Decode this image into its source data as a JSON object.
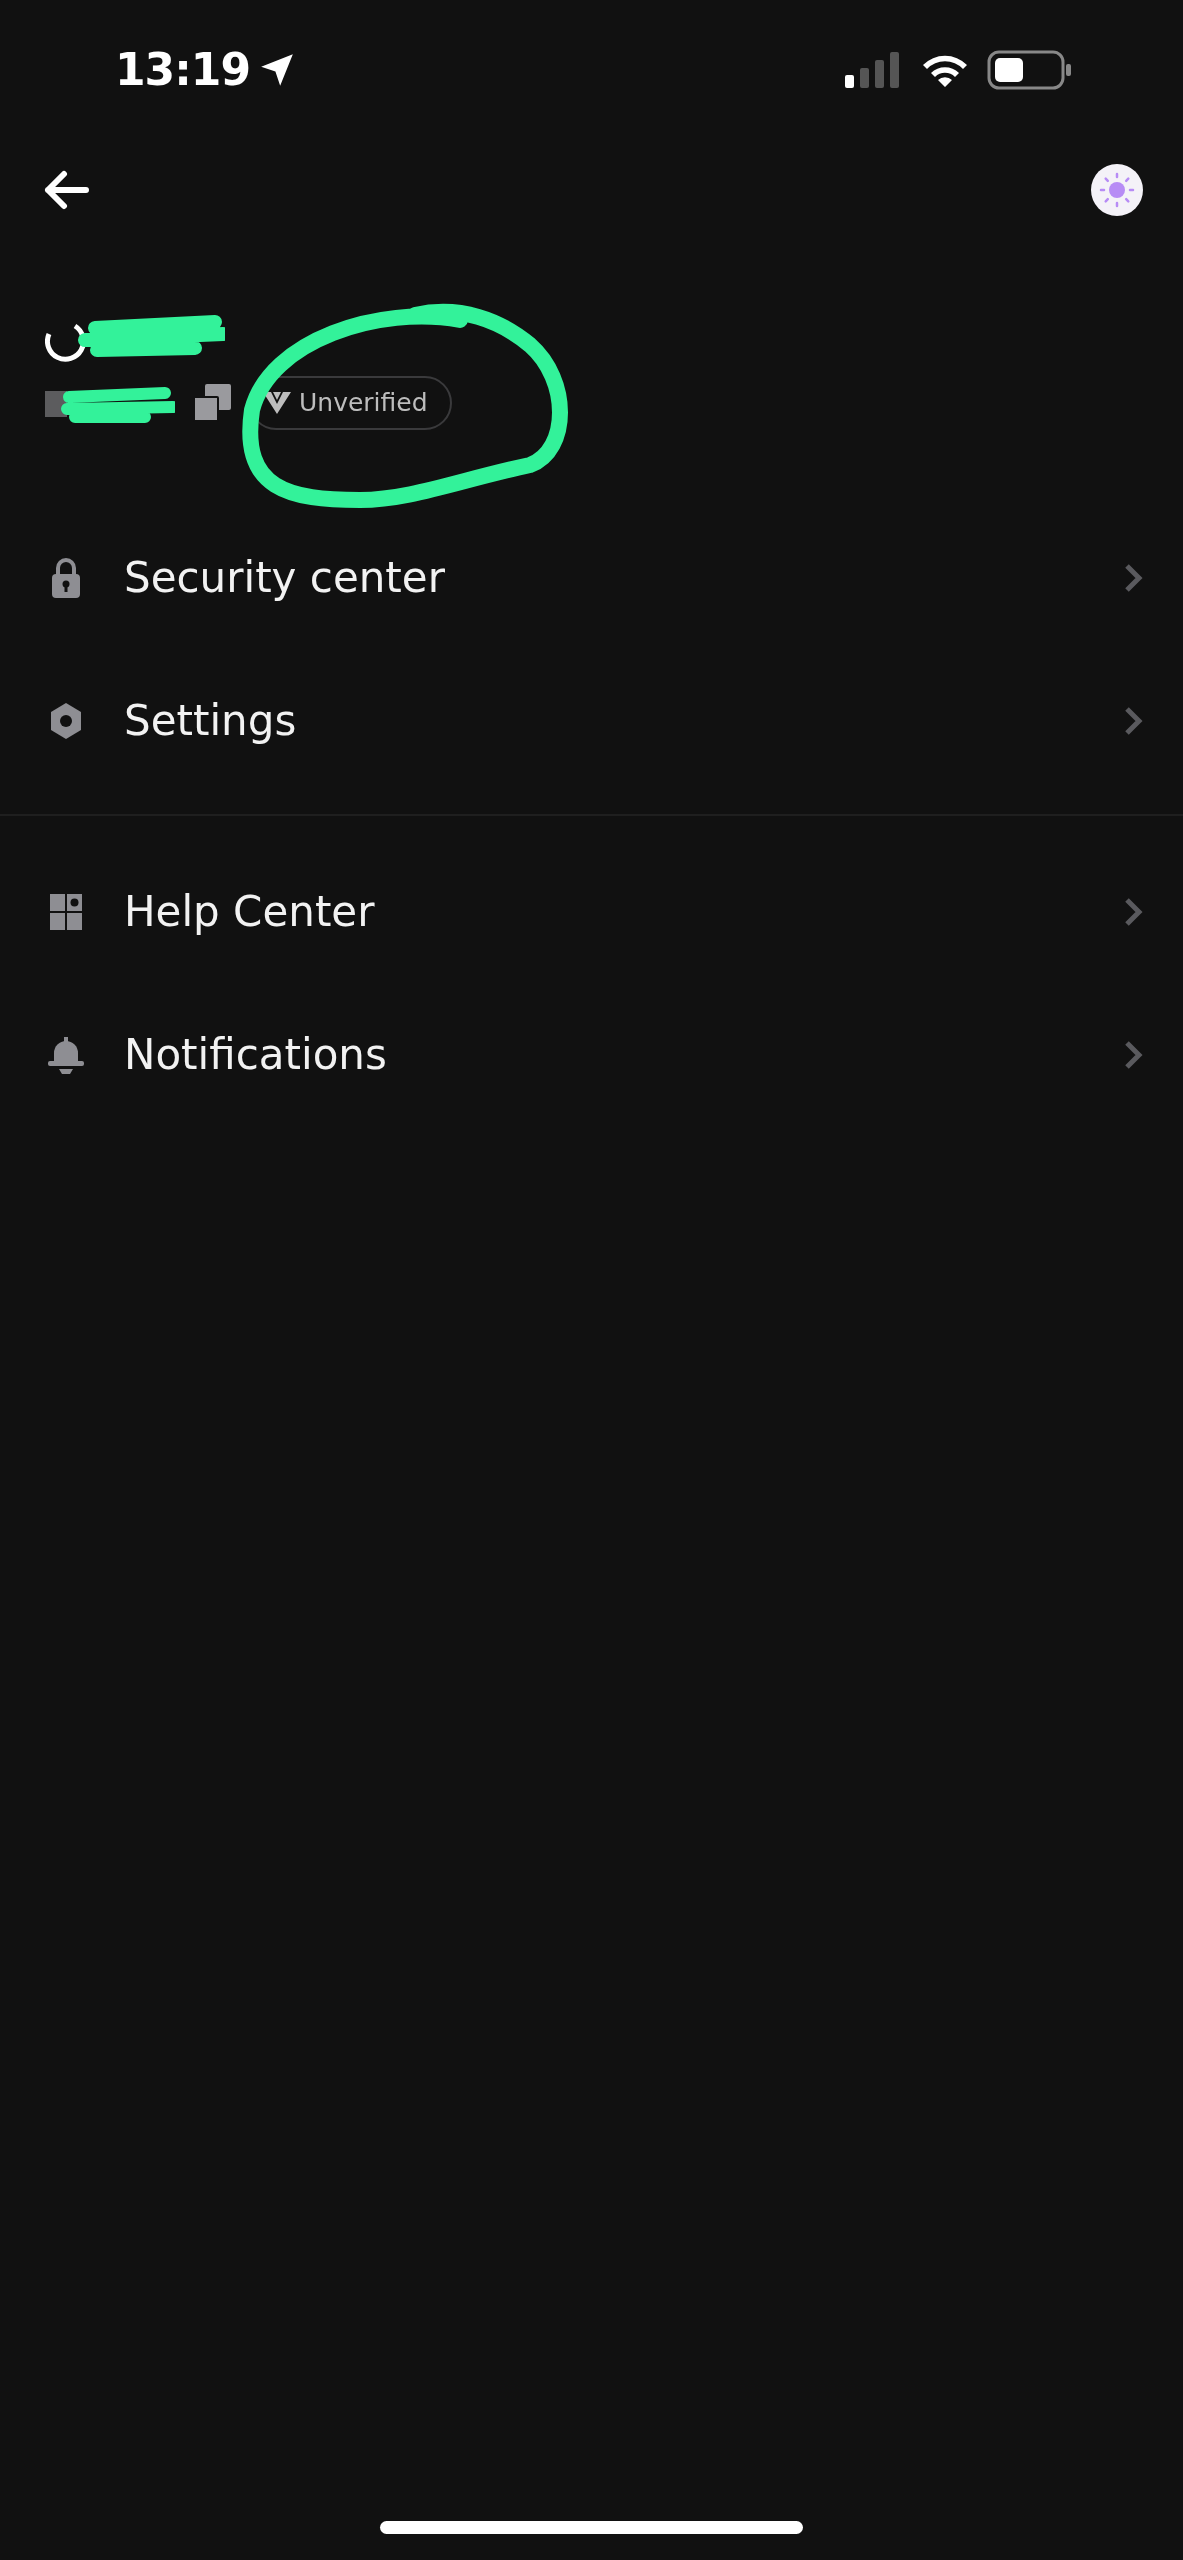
{
  "status_bar": {
    "time": "13:19"
  },
  "profile": {
    "badge": "Unverified"
  },
  "menu_groups": [
    {
      "items": [
        {
          "label": "Security center"
        },
        {
          "label": "Settings"
        }
      ]
    },
    {
      "items": [
        {
          "label": "Help Center"
        },
        {
          "label": "Notifications"
        }
      ]
    }
  ]
}
